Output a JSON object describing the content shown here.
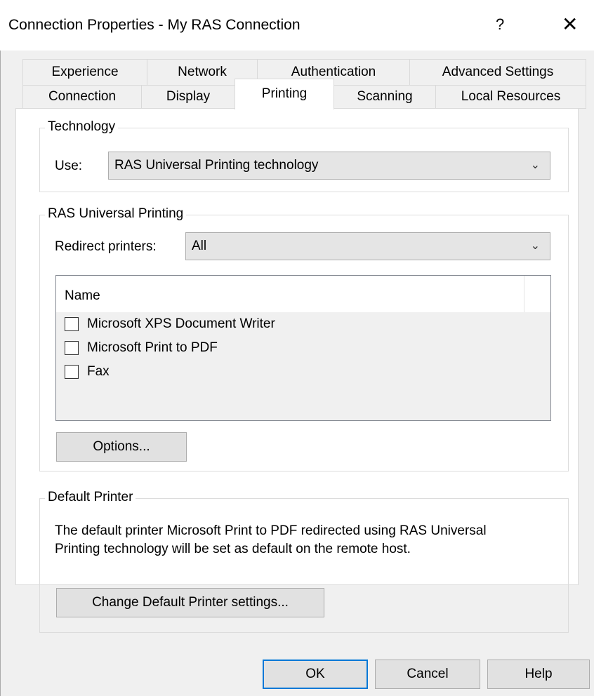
{
  "window": {
    "title": "Connection Properties - My RAS Connection",
    "help_label": "?",
    "close_label": "✕"
  },
  "tabs": {
    "row1": [
      "Experience",
      "Network",
      "Authentication",
      "Advanced Settings"
    ],
    "row2": [
      "Connection",
      "Display",
      "Printing",
      "Scanning",
      "Local Resources"
    ],
    "active": "Printing"
  },
  "technology": {
    "legend": "Technology",
    "use_label": "Use:",
    "use_value": "RAS Universal Printing technology"
  },
  "universal_printing": {
    "legend": "RAS Universal Printing",
    "redirect_label": "Redirect printers:",
    "redirect_value": "All",
    "list_header": "Name",
    "printers": [
      {
        "name": "Microsoft XPS Document Writer",
        "checked": false
      },
      {
        "name": "Microsoft Print to PDF",
        "checked": false
      },
      {
        "name": "Fax",
        "checked": false
      }
    ],
    "options_button": "Options..."
  },
  "default_printer": {
    "legend": "Default Printer",
    "line1": "The default printer Microsoft Print to PDF redirected using RAS Universal",
    "line2": "Printing technology will be set as default on the remote host.",
    "change_button": "Change Default Printer settings..."
  },
  "buttons": {
    "ok": "OK",
    "cancel": "Cancel",
    "help": "Help"
  },
  "icons": {
    "dropdown": "chevron-down-icon",
    "close": "close-icon",
    "help": "help-icon"
  },
  "colors": {
    "accent": "#0078d7",
    "background": "#f0f0f0",
    "panel": "#ffffff"
  }
}
